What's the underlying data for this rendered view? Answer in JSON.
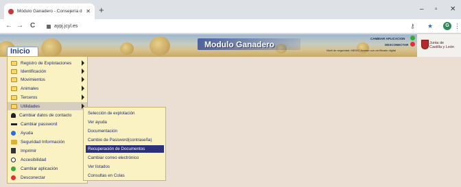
{
  "browser": {
    "tab_title": "Módulo Ganadero - Consejería d",
    "tab_close": "✕",
    "new_tab": "+",
    "url": "aypj.jcyl.es",
    "back": "←",
    "forward": "→",
    "reload": "C",
    "minimize": "–",
    "maximize": "▫",
    "close": "✕",
    "menu_dots": "⋮",
    "key_icon": "⚷",
    "star_icon": "★",
    "avatar_letter": "G"
  },
  "header": {
    "app_title": "Modulo Ganadero",
    "change_app_label": "CAMBIAR APLICACION",
    "disconnect_label": "DESCONECTAR",
    "user_line": "Nivel de seguridad: MEDIO   Acceso con certificado digital",
    "logo_line1": "Junta de",
    "logo_line2": "Castilla y León",
    "inicio": "Inicio"
  },
  "menu": {
    "items": [
      {
        "label": "Registro de Explotaciones",
        "icon": "folder-icon",
        "submenu": true
      },
      {
        "label": "Identificación",
        "icon": "folder-icon",
        "submenu": true
      },
      {
        "label": "Movimientos",
        "icon": "folder-icon",
        "submenu": true
      },
      {
        "label": "Animales",
        "icon": "folder-icon",
        "submenu": true
      },
      {
        "label": "Terceros",
        "icon": "folder-icon",
        "submenu": true
      },
      {
        "label": "Utilidades",
        "icon": "folder-icon",
        "submenu": true,
        "selected": true
      },
      {
        "label": "Cambiar datos de contacto",
        "icon": "person-icon"
      },
      {
        "label": "Cambiar password",
        "icon": "key-icon"
      },
      {
        "label": "Ayuda",
        "icon": "help-icon"
      },
      {
        "label": "Seguridad Información",
        "icon": "security-icon"
      },
      {
        "label": "Imprimir",
        "icon": "print-icon"
      },
      {
        "label": "Accesibilidad",
        "icon": "accessibility-icon"
      },
      {
        "label": "Cambiar aplicación",
        "icon": "green-circle-icon"
      },
      {
        "label": "Desconectar",
        "icon": "red-circle-icon"
      }
    ]
  },
  "submenu": {
    "items": [
      {
        "label": "Selección de explotación"
      },
      {
        "label": "Ver ayuda"
      },
      {
        "label": "Documentación"
      },
      {
        "label": "Cambio de Password(contraseña)"
      },
      {
        "label": "Recuperación de Documentos",
        "active": true
      },
      {
        "label": "Cambiar correo electrónico"
      },
      {
        "label": "Ver listados"
      },
      {
        "label": "Consultas en Colas"
      }
    ]
  },
  "colors": {
    "menu_bg": "#fbf2c3",
    "menu_text": "#1f2a66",
    "active_item_bg": "#2c2f7a",
    "page_bg": "#eadfd2"
  }
}
